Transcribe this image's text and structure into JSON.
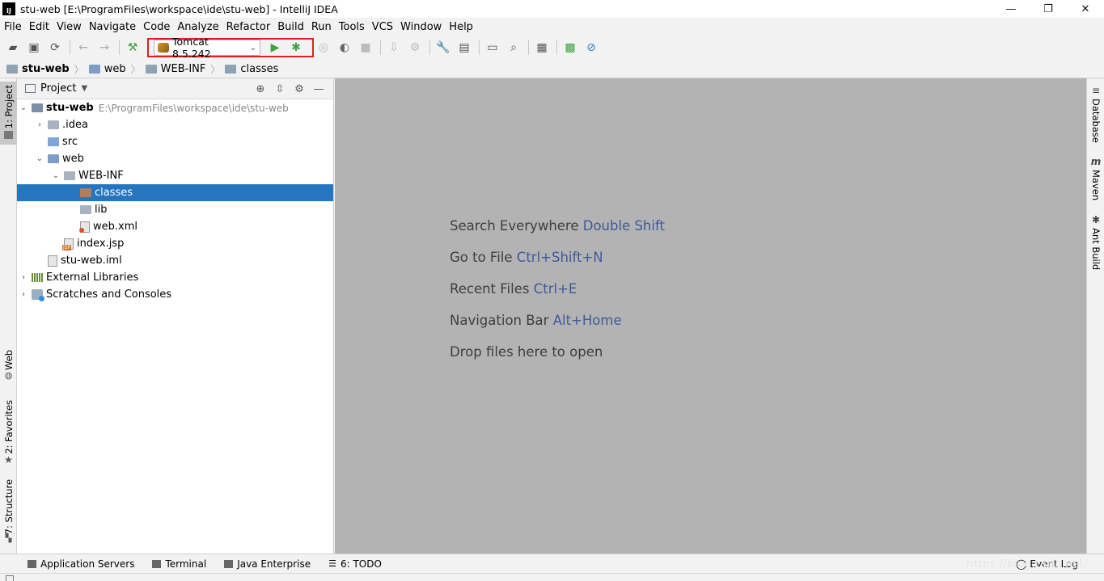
{
  "window": {
    "title": "stu-web [E:\\ProgramFiles\\workspace\\ide\\stu-web] - IntelliJ IDEA",
    "logo": "IJ",
    "controls": {
      "minimize": "—",
      "restore": "❐",
      "close": "✕"
    }
  },
  "menu": [
    "File",
    "Edit",
    "View",
    "Navigate",
    "Code",
    "Analyze",
    "Refactor",
    "Build",
    "Run",
    "Tools",
    "VCS",
    "Window",
    "Help"
  ],
  "toolbar": {
    "run_config": "Tomcat 8.5.242",
    "accent_red": "#e02020",
    "run_color": "#3fa13f",
    "debug_color": "#3fa13f"
  },
  "breadcrumb": [
    "stu-web",
    "web",
    "WEB-INF",
    "classes"
  ],
  "left_tabs": {
    "project": "1: Project",
    "web": "Web",
    "favorites": "2: Favorites",
    "structure": "7: Structure"
  },
  "right_tabs": {
    "database": "Database",
    "maven": "Maven",
    "ant": "Ant Build"
  },
  "project_panel": {
    "title": "Project",
    "tree": [
      {
        "label": "stu-web",
        "path": "E:\\ProgramFiles\\workspace\\ide\\stu-web"
      },
      {
        "label": ".idea"
      },
      {
        "label": "src"
      },
      {
        "label": "web"
      },
      {
        "label": "WEB-INF"
      },
      {
        "label": "classes"
      },
      {
        "label": "lib"
      },
      {
        "label": "web.xml"
      },
      {
        "label": "index.jsp"
      },
      {
        "label": "stu-web.iml"
      },
      {
        "label": "External Libraries"
      },
      {
        "label": "Scratches and Consoles"
      }
    ],
    "selected_color": "#2675bf"
  },
  "editor": {
    "hints": [
      {
        "text": "Search Everywhere",
        "shortcut": "Double Shift"
      },
      {
        "text": "Go to File",
        "shortcut": "Ctrl+Shift+N"
      },
      {
        "text": "Recent Files",
        "shortcut": "Ctrl+E"
      },
      {
        "text": "Navigation Bar",
        "shortcut": "Alt+Home"
      },
      {
        "text": "Drop files here to open",
        "shortcut": ""
      }
    ]
  },
  "bottom_tabs": [
    "Application Servers",
    "Terminal",
    "Java Enterprise",
    "6: TODO"
  ],
  "event_log": "Event Log",
  "watermark": "https://blog.csdn.net/..."
}
